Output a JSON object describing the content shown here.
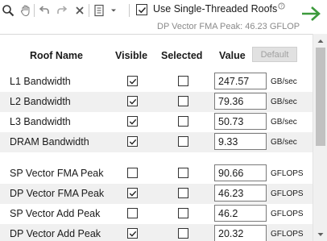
{
  "toolbar": {
    "single_threaded_label": "Use Single-Threaded Roofs",
    "single_threaded_checked": true,
    "status_text": "DP Vector FMA Peak: 46.23 GFLOP"
  },
  "table": {
    "headers": {
      "name": "Roof Name",
      "visible": "Visible",
      "selected": "Selected",
      "value": "Value"
    },
    "default_button": "Default",
    "rows": [
      {
        "name": "L1 Bandwidth",
        "visible": true,
        "selected": false,
        "value": "247.57",
        "unit": "GB/sec"
      },
      {
        "name": "L2 Bandwidth",
        "visible": true,
        "selected": false,
        "value": "79.36",
        "unit": "GB/sec"
      },
      {
        "name": "L3 Bandwidth",
        "visible": true,
        "selected": false,
        "value": "50.73",
        "unit": "GB/sec"
      },
      {
        "name": "DRAM Bandwidth",
        "visible": true,
        "selected": false,
        "value": "9.33",
        "unit": "GB/sec"
      },
      {
        "name": "SP Vector FMA Peak",
        "visible": false,
        "selected": false,
        "value": "90.66",
        "unit": "GFLOPS"
      },
      {
        "name": "DP Vector FMA Peak",
        "visible": true,
        "selected": false,
        "value": "46.23",
        "unit": "GFLOPS"
      },
      {
        "name": "SP Vector Add Peak",
        "visible": false,
        "selected": false,
        "value": "46.2",
        "unit": "GFLOPS"
      },
      {
        "name": "DP Vector Add Peak",
        "visible": true,
        "selected": false,
        "value": "20.32",
        "unit": "GFLOPS"
      }
    ]
  },
  "colors": {
    "go_arrow": "#3c9a3c",
    "row_shade": "#f0f0f0"
  }
}
